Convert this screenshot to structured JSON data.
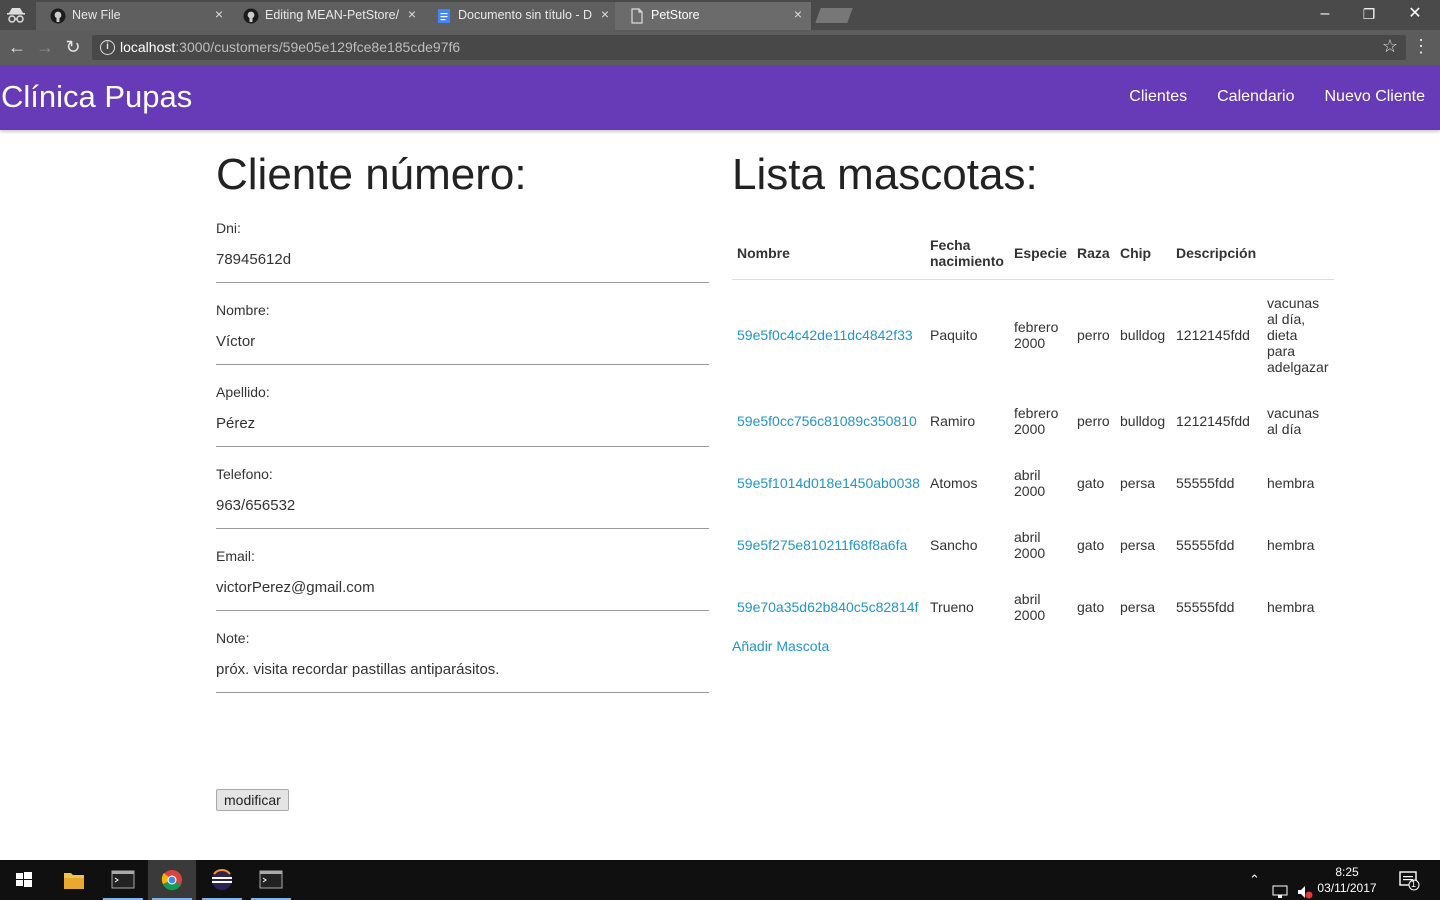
{
  "browser": {
    "tabs": [
      {
        "title": "New File",
        "icon": "github-icon"
      },
      {
        "title": "Editing MEAN-PetStore/R",
        "icon": "github-icon"
      },
      {
        "title": "Documento sin título - D",
        "icon": "google-docs-icon"
      },
      {
        "title": "PetStore",
        "icon": "page-icon"
      }
    ],
    "close_glyph": "×",
    "url_host": "localhost",
    "url_path": ":3000/customers/59e05e129fce8e185cde97f6",
    "window_controls": {
      "minimize": "–",
      "maximize": "❐",
      "close": "✕"
    }
  },
  "navbar": {
    "brand": "Clínica Pupas",
    "links": [
      "Clientes",
      "Calendario",
      "Nuevo Cliente"
    ],
    "color": "#673ab7"
  },
  "customer": {
    "title": "Cliente número:",
    "fields": [
      {
        "label": "Dni:",
        "value": "78945612d"
      },
      {
        "label": "Nombre:",
        "value": "Víctor"
      },
      {
        "label": "Apellido:",
        "value": "Pérez"
      },
      {
        "label": "Telefono:",
        "value": "963/656532"
      },
      {
        "label": "Email:",
        "value": "victorPerez@gmail.com"
      },
      {
        "label": "Note:",
        "value": "próx. visita recordar pastillas antiparásitos."
      }
    ],
    "modify_button": "modificar"
  },
  "pets": {
    "title": "Lista mascotas:",
    "headers": [
      "Nombre",
      "Fecha nacimiento",
      "Especie",
      "Raza",
      "Chip",
      "Descripción"
    ],
    "rows": [
      {
        "id": "59e5f0c4c42de11dc4842f33",
        "name": "Paquito",
        "birth": "febrero 2000",
        "species": "perro",
        "breed": "bulldog",
        "chip": "1212145fdd",
        "description": "vacunas al día, dieta para adelgazar"
      },
      {
        "id": "59e5f0cc756c81089c350810",
        "name": "Ramiro",
        "birth": "febrero 2000",
        "species": "perro",
        "breed": "bulldog",
        "chip": "1212145fdd",
        "description": "vacunas al día"
      },
      {
        "id": "59e5f1014d018e1450ab0038",
        "name": "Atomos",
        "birth": "abril 2000",
        "species": "gato",
        "breed": "persa",
        "chip": "55555fdd",
        "description": "hembra"
      },
      {
        "id": "59e5f275e810211f68f8a6fa",
        "name": "Sancho",
        "birth": "abril 2000",
        "species": "gato",
        "breed": "persa",
        "chip": "55555fdd",
        "description": "hembra"
      },
      {
        "id": "59e70a35d62b840c5c82814f",
        "name": "Trueno",
        "birth": "abril 2000",
        "species": "gato",
        "breed": "persa",
        "chip": "55555fdd",
        "description": "hembra"
      }
    ],
    "add_link": "Añadir Mascota",
    "link_color": "#2196c9"
  },
  "taskbar": {
    "apps": [
      "start-icon",
      "file-explorer-icon",
      "terminal-icon",
      "chrome-icon",
      "eclipse-icon",
      "terminal-icon"
    ],
    "time": "8:25",
    "date": "03/11/2017",
    "notification_count": "1"
  }
}
